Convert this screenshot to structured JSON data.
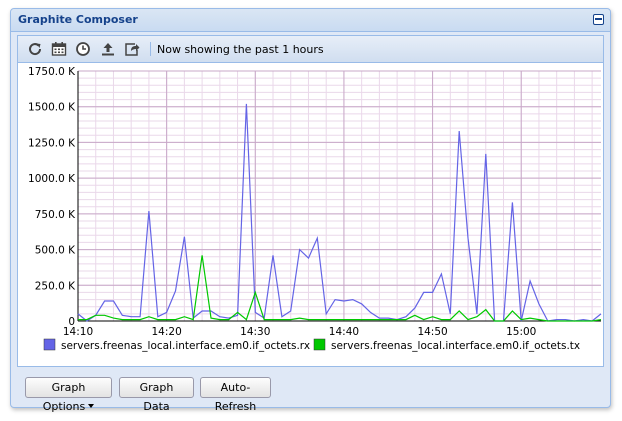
{
  "window": {
    "title": "Graphite Composer"
  },
  "toolbar": {
    "icons": [
      "refresh-icon",
      "calendar-icon",
      "clock-icon",
      "upload-icon",
      "share-icon"
    ],
    "status_text": "Now showing the past 1 hours"
  },
  "footer": {
    "graph_options_label": "Graph Options",
    "graph_data_label": "Graph Data",
    "auto_refresh_label": "Auto-Refresh"
  },
  "chart_data": {
    "type": "line",
    "title": "",
    "xlabel": "",
    "ylabel": "",
    "x_ticks": [
      "14:10",
      "14:20",
      "14:30",
      "14:40",
      "14:50",
      "15:00"
    ],
    "y_ticks": [
      "0",
      "250.0 K",
      "500.0 K",
      "750.0 K",
      "1000.0 K",
      "1250.0 K",
      "1500.0 K",
      "1750.0 K"
    ],
    "ylim": [
      0,
      1750000
    ],
    "xlim": [
      "14:10",
      "15:09"
    ],
    "grid": true,
    "legend_placement": "bottom",
    "series": [
      {
        "name": "servers.freenas_local.interface.em0.if_octets.rx",
        "color": "#6464e6",
        "x": [
          "14:10",
          "14:11",
          "14:12",
          "14:13",
          "14:14",
          "14:15",
          "14:16",
          "14:17",
          "14:18",
          "14:19",
          "14:20",
          "14:21",
          "14:22",
          "14:23",
          "14:24",
          "14:25",
          "14:26",
          "14:27",
          "14:28",
          "14:29",
          "14:30",
          "14:31",
          "14:32",
          "14:33",
          "14:34",
          "14:35",
          "14:36",
          "14:37",
          "14:38",
          "14:39",
          "14:40",
          "14:41",
          "14:42",
          "14:43",
          "14:44",
          "14:45",
          "14:46",
          "14:47",
          "14:48",
          "14:49",
          "14:50",
          "14:51",
          "14:52",
          "14:53",
          "14:54",
          "14:55",
          "14:56",
          "14:57",
          "14:58",
          "14:59",
          "15:00",
          "15:01",
          "15:02",
          "15:03",
          "15:04",
          "15:05",
          "15:06",
          "15:07",
          "15:08",
          "15:09"
        ],
        "values": [
          50000,
          0,
          40000,
          140000,
          140000,
          40000,
          30000,
          30000,
          770000,
          30000,
          60000,
          210000,
          590000,
          20000,
          70000,
          70000,
          30000,
          20000,
          40000,
          1520000,
          60000,
          20000,
          460000,
          30000,
          70000,
          500000,
          440000,
          580000,
          50000,
          150000,
          140000,
          150000,
          120000,
          60000,
          20000,
          20000,
          10000,
          30000,
          90000,
          200000,
          200000,
          330000,
          50000,
          1330000,
          580000,
          50000,
          1170000,
          0,
          0,
          830000,
          0,
          280000,
          120000,
          0,
          10000,
          10000,
          0,
          10000,
          0,
          50000
        ]
      },
      {
        "name": "servers.freenas_local.interface.em0.if_octets.tx",
        "color": "#00c800",
        "x": [
          "14:10",
          "14:11",
          "14:12",
          "14:13",
          "14:14",
          "14:15",
          "14:16",
          "14:17",
          "14:18",
          "14:19",
          "14:20",
          "14:21",
          "14:22",
          "14:23",
          "14:24",
          "14:25",
          "14:26",
          "14:27",
          "14:28",
          "14:29",
          "14:30",
          "14:31",
          "14:32",
          "14:33",
          "14:34",
          "14:35",
          "14:36",
          "14:37",
          "14:38",
          "14:39",
          "14:40",
          "14:41",
          "14:42",
          "14:43",
          "14:44",
          "14:45",
          "14:46",
          "14:47",
          "14:48",
          "14:49",
          "14:50",
          "14:51",
          "14:52",
          "14:53",
          "14:54",
          "14:55",
          "14:56",
          "14:57",
          "14:58",
          "14:59",
          "15:00",
          "15:01",
          "15:02",
          "15:03",
          "15:04",
          "15:05",
          "15:06",
          "15:07",
          "15:08",
          "15:09"
        ],
        "values": [
          10000,
          10000,
          40000,
          40000,
          20000,
          10000,
          10000,
          10000,
          30000,
          10000,
          10000,
          10000,
          30000,
          10000,
          460000,
          20000,
          10000,
          10000,
          60000,
          10000,
          200000,
          10000,
          10000,
          10000,
          10000,
          20000,
          10000,
          10000,
          10000,
          10000,
          10000,
          10000,
          10000,
          10000,
          10000,
          10000,
          10000,
          10000,
          40000,
          10000,
          30000,
          10000,
          10000,
          70000,
          10000,
          30000,
          80000,
          0,
          0,
          70000,
          10000,
          20000,
          10000,
          0,
          0,
          0,
          0,
          0,
          0,
          10000
        ]
      }
    ]
  }
}
